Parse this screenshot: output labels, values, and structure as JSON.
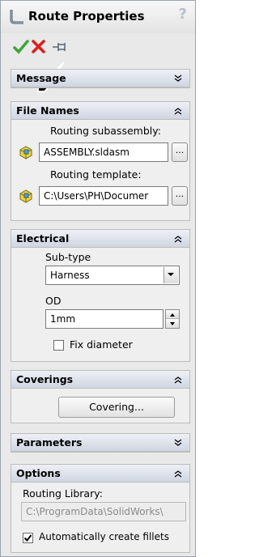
{
  "header": {
    "title": "Route Properties",
    "help_glyph": "?",
    "actions": {
      "ok_icon": "check-icon",
      "cancel_icon": "x-icon",
      "pin_icon": "pushpin-icon"
    }
  },
  "groups": {
    "message": {
      "title": "Message",
      "expanded": false
    },
    "file_names": {
      "title": "File Names",
      "expanded": true,
      "subassembly_label": "Routing subassembly:",
      "subassembly_value": "ASSEMBLY.sldasm",
      "template_label": "Routing template:",
      "template_value": "C:\\Users\\PH\\Documer",
      "browse_label": "..."
    },
    "electrical": {
      "title": "Electrical",
      "expanded": true,
      "subtype_label": "Sub-type",
      "subtype_value": "Harness",
      "od_label": "OD",
      "od_value": "1mm",
      "fix_diameter_label": "Fix diameter",
      "fix_diameter_checked": false
    },
    "coverings": {
      "title": "Coverings",
      "expanded": true,
      "covering_button": "Covering..."
    },
    "parameters": {
      "title": "Parameters",
      "expanded": false
    },
    "options": {
      "title": "Options",
      "expanded": true,
      "library_label": "Routing Library:",
      "library_value": "C:\\ProgramData\\SolidWorks\\",
      "fillets_label": "Automatically create fillets",
      "fillets_checked": true
    }
  },
  "colors": {
    "ok_green": "#3fa43a",
    "cancel_red": "#e01d1d",
    "group_header": "#cfd6e2"
  }
}
